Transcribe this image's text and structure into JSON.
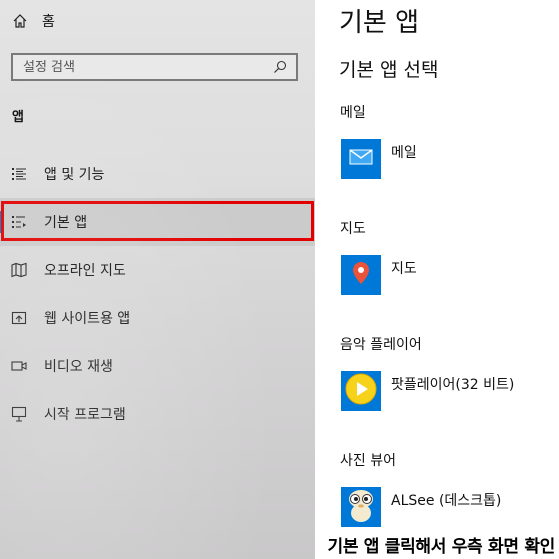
{
  "sidebar": {
    "home_label": "홈",
    "search_placeholder": "설정 검색",
    "section_heading": "앱",
    "items": [
      {
        "label": "앱 및 기능",
        "icon": "apps-features-icon"
      },
      {
        "label": "기본 앱",
        "icon": "default-apps-icon",
        "selected": true
      },
      {
        "label": "오프라인 지도",
        "icon": "offline-maps-icon"
      },
      {
        "label": "웹 사이트용 앱",
        "icon": "apps-for-websites-icon"
      },
      {
        "label": "비디오 재생",
        "icon": "video-playback-icon"
      },
      {
        "label": "시작 프로그램",
        "icon": "startup-icon"
      }
    ]
  },
  "main": {
    "title": "기본 앱",
    "subtitle": "기본 앱 선택",
    "categories": [
      {
        "label": "메일",
        "app": "메일",
        "tile_color": "#0078d7"
      },
      {
        "label": "지도",
        "app": "지도",
        "tile_color": "#0078d7"
      },
      {
        "label": "음악 플레이어",
        "app": "팟플레이어(32 비트)",
        "tile_color": "#0078d7"
      },
      {
        "label": "사진 뷰어",
        "app": "ALSee (데스크톱)",
        "tile_color": "#0078d7"
      }
    ]
  },
  "caption": "기본 앱 클릭해서 우측 화면 확인",
  "colors": {
    "accent": "#0078d7",
    "highlight": "#e20000"
  }
}
